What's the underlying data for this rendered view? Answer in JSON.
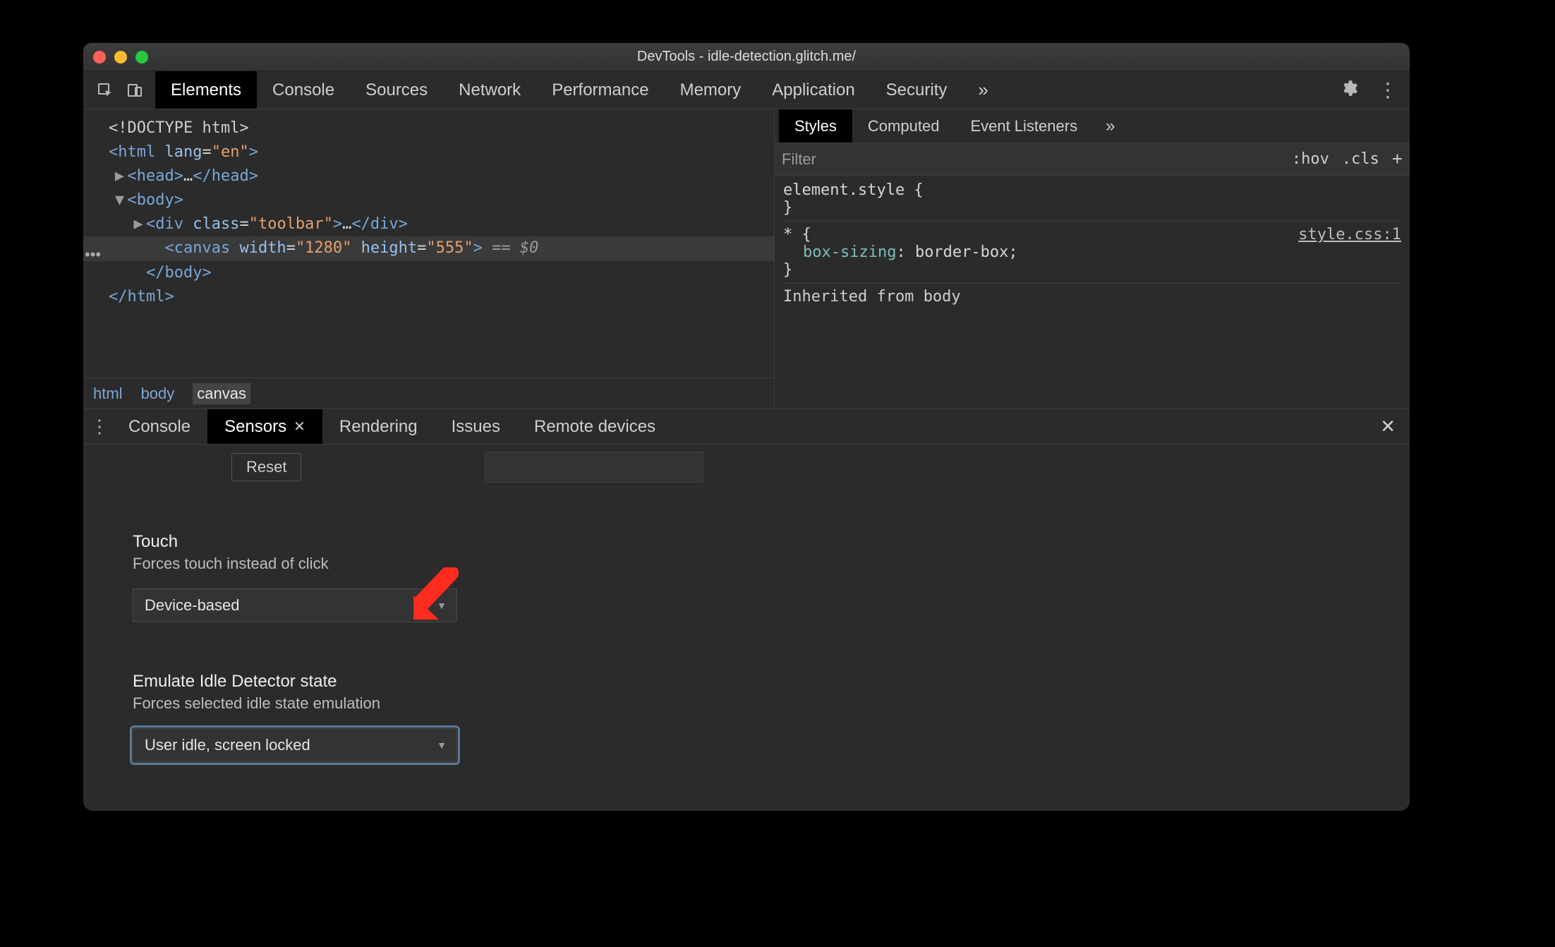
{
  "window": {
    "title": "DevTools - idle-detection.glitch.me/"
  },
  "toolbar": {
    "tabs": [
      "Elements",
      "Console",
      "Sources",
      "Network",
      "Performance",
      "Memory",
      "Application",
      "Security"
    ],
    "active_tab_index": 0,
    "more_glyph": "»"
  },
  "dom": {
    "lines": [
      {
        "indent": 0,
        "html": "<span class='comment'>&lt;!DOCTYPE html&gt;</span>"
      },
      {
        "indent": 0,
        "html": "<span class='tag'>&lt;html</span> <span class='attr'>lang</span>=<span class='val'>\"en\"</span><span class='tag'>&gt;</span>"
      },
      {
        "indent": 1,
        "tri": "▶",
        "html": "<span class='tag'>&lt;head&gt;</span><span class='txt'>…</span><span class='tag'>&lt;/head&gt;</span>"
      },
      {
        "indent": 1,
        "tri": "▼",
        "html": "<span class='tag'>&lt;body&gt;</span>"
      },
      {
        "indent": 2,
        "tri": "▶",
        "html": "<span class='tag'>&lt;div</span> <span class='attr'>class</span>=<span class='val'>\"toolbar\"</span><span class='tag'>&gt;</span><span class='txt'>…</span><span class='tag'>&lt;/div&gt;</span>"
      },
      {
        "indent": 3,
        "selected": true,
        "html": "<span class='tag'>&lt;canvas</span> <span class='attr'>width</span>=<span class='val'>\"1280\"</span> <span class='attr'>height</span>=<span class='val'>\"555\"</span><span class='tag'>&gt;</span> <span class='muted'>== $0</span>"
      },
      {
        "indent": 2,
        "html": "<span class='tag'>&lt;/body&gt;</span>"
      },
      {
        "indent": 0,
        "html": "<span class='tag'>&lt;/html&gt;</span>"
      }
    ],
    "gutter_dots": "•••"
  },
  "breadcrumbs": {
    "items": [
      "html",
      "body",
      "canvas"
    ],
    "active_index": 2
  },
  "styles_panel": {
    "tabs": [
      "Styles",
      "Computed",
      "Event Listeners"
    ],
    "active_tab_index": 0,
    "more_glyph": "»",
    "filter_placeholder": "Filter",
    "hov": ":hov",
    "cls": ".cls",
    "plus": "+",
    "rules": [
      {
        "selector": "element.style {",
        "body_lines": [],
        "close": "}"
      },
      {
        "selector": "* {",
        "src": "style.css:1",
        "body_lines": [
          "box-sizing: border-box;"
        ],
        "close": "}"
      }
    ],
    "inherited_label": "Inherited from ",
    "inherited_from": "body"
  },
  "drawer": {
    "tabs": [
      "Console",
      "Sensors",
      "Rendering",
      "Issues",
      "Remote devices"
    ],
    "active_tab_index": 1,
    "closeable_indices": [
      1
    ],
    "reset_label": "Reset",
    "touch": {
      "title": "Touch",
      "desc": "Forces touch instead of click",
      "value": "Device-based"
    },
    "idle": {
      "title": "Emulate Idle Detector state",
      "desc": "Forces selected idle state emulation",
      "value": "User idle, screen locked"
    }
  },
  "annotation": {
    "color": "#ff2b1f"
  }
}
